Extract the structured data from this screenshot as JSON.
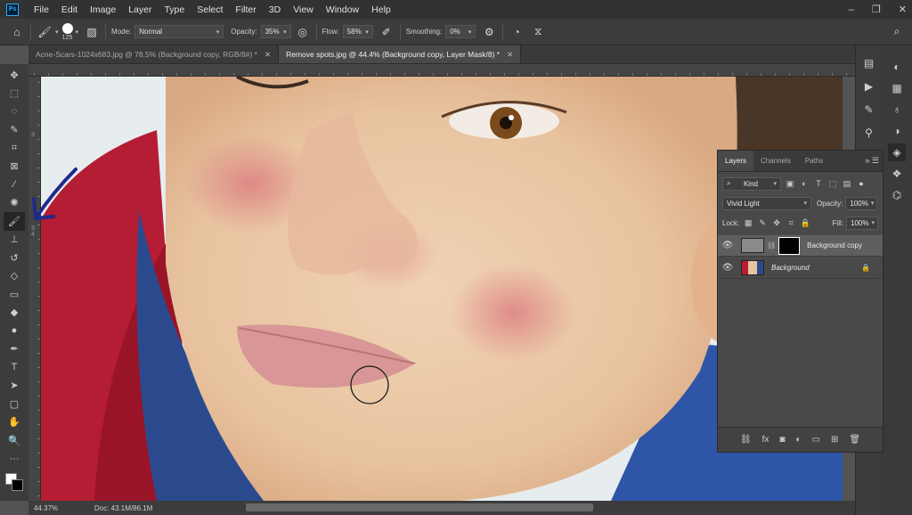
{
  "menubar": {
    "logo": "Ps",
    "items": [
      "File",
      "Edit",
      "Image",
      "Layer",
      "Type",
      "Select",
      "Filter",
      "3D",
      "View",
      "Window",
      "Help"
    ],
    "window_controls": [
      "–",
      "❐",
      "✕"
    ]
  },
  "options": {
    "brush_size": "125",
    "mode_label": "Mode:",
    "mode_value": "Normal",
    "opacity_label": "Opacity:",
    "opacity_value": "35%",
    "flow_label": "Flow:",
    "flow_value": "58%",
    "smoothing_label": "Smoothing:",
    "smoothing_value": "0%"
  },
  "tabs": [
    {
      "label": "Acne-Scars-1024x683.jpg @ 78.5% (Background copy, RGB/8#) *",
      "active": false
    },
    {
      "label": "Remove spots.jpg @ 44.4% (Background copy, Layer Mask/8) *",
      "active": true
    }
  ],
  "rulers": {
    "left_numbers": [
      "3",
      "3",
      "4"
    ]
  },
  "layers_panel": {
    "tabs": [
      "Layers",
      "Channels",
      "Paths"
    ],
    "filter_kind": "Kind",
    "blend_mode": "Vivid Light",
    "opacity_label": "Opacity:",
    "opacity_value": "100%",
    "lock_label": "Lock:",
    "fill_label": "Fill:",
    "fill_value": "100%",
    "layers": [
      {
        "name": "Background copy",
        "selected": true
      },
      {
        "name": "Background",
        "selected": false
      }
    ],
    "footer_icons": [
      "link-icon",
      "fx-icon",
      "mask-icon",
      "adjustment-icon",
      "group-icon",
      "new-layer-icon",
      "trash-icon"
    ]
  },
  "status": {
    "zoom": "44.37%",
    "doc": "Doc: 43.1M/86.1M"
  },
  "colors": {
    "foreground": "#ffffff",
    "background": "#000000",
    "annotation_arrow": "#1f2a8a"
  }
}
